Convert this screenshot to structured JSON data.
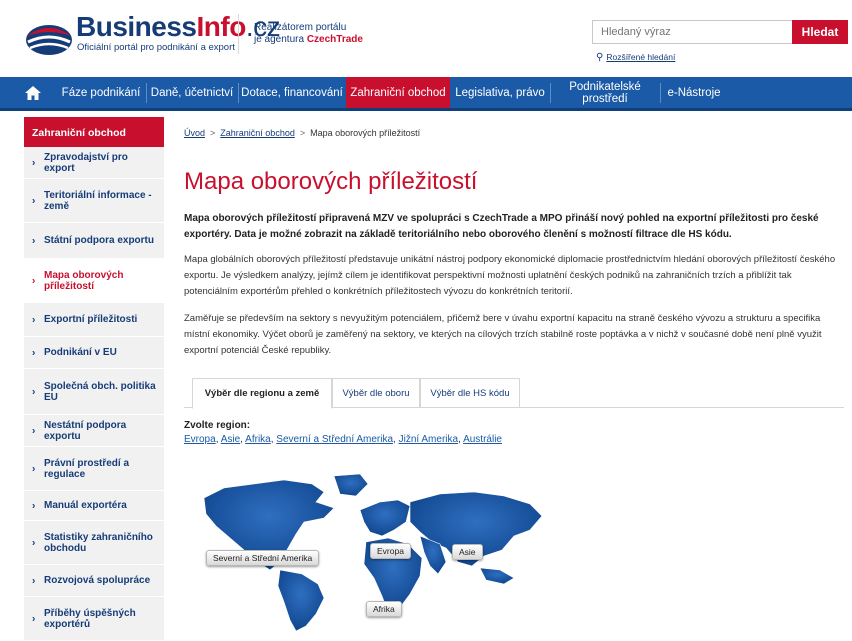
{
  "header": {
    "logo_main": "Business",
    "logo_info": "Info",
    "logo_cz": ".cz",
    "logo_sub": "Oficiální portál pro podnikání a export",
    "realizator_line1": "Realizátorem portálu",
    "realizator_line2": "je agentura",
    "realizator_brand": "CzechTrade",
    "search_placeholder": "Hledaný výraz",
    "search_button": "Hledat",
    "advanced_search": "Rozšířené hledání"
  },
  "nav": {
    "items": [
      {
        "label": "Fáze podnikání"
      },
      {
        "label": "Daně, účetnictví"
      },
      {
        "label": "Dotace, financování"
      },
      {
        "label": "Zahraniční obchod"
      },
      {
        "label": "Legislativa, právo"
      },
      {
        "label": "Podnikatelské prostředí"
      },
      {
        "label": "e-Nástroje"
      }
    ]
  },
  "sidebar": {
    "heading": "Zahraniční obchod",
    "items": [
      {
        "label": "Zpravodajství pro export"
      },
      {
        "label": "Teritoriální informace - země"
      },
      {
        "label": "Státní podpora exportu"
      },
      {
        "label": "Mapa oborových příležitostí"
      },
      {
        "label": "Exportní příležitosti"
      },
      {
        "label": "Podnikání v EU"
      },
      {
        "label": "Společná obch. politika EU"
      },
      {
        "label": "Nestátní podpora exportu"
      },
      {
        "label": "Právní prostředí a regulace"
      },
      {
        "label": "Manuál exportéra"
      },
      {
        "label": "Statistiky zahraničního obchodu"
      },
      {
        "label": "Rozvojová spolupráce"
      },
      {
        "label": "Příběhy úspěšných exportérů"
      }
    ]
  },
  "breadcrumb": {
    "home": "Úvod",
    "section": "Zahraniční obchod",
    "current": "Mapa oborových příležitostí"
  },
  "main": {
    "title": "Mapa oborových příležitostí",
    "lead": "Mapa oborových příležitostí připravená MZV ve spolupráci s CzechTrade a MPO přináší nový pohled na exportní příležitosti pro české exportéry. Data je možné zobrazit na základě teritoriálního nebo oborového členění s možností filtrace dle HS kódu.",
    "para1": "Mapa globálních oborových příležitostí představuje unikátní nástroj podpory ekonomické diplomacie prostřednictvím hledání oborových příležitostí českého exportu. Je výsledkem analýzy, jejímž cílem je identifikovat perspektivní možnosti uplatnění českých podniků na zahraničních trzích a přiblížit tak potenciálním exportérům přehled o konkrétních příležitostech vývozu do konkrétních teritorií.",
    "para2": "Zaměřuje se především na sektory s nevyužitým potenciálem, přičemž bere v úvahu exportní kapacitu na straně českého vývozu a strukturu a specifika místní ekonomiky. Výčet oborů je zaměřený na sektory, ve kterých na cílových trzích stabilně roste poptávka a v nichž v současné době není plně využit exportní potenciál České republiky.",
    "tabs": [
      {
        "label": "Výběr dle regionu a země"
      },
      {
        "label": "Výběr dle oboru"
      },
      {
        "label": "Výběr dle HS kódu"
      }
    ],
    "region_label": "Zvolte region:",
    "regions": [
      "Evropa",
      "Asie",
      "Afrika",
      "Severní a Střední Amerika",
      "Jižní Amerika",
      "Austrálie"
    ],
    "map_labels": {
      "north_america": "Severní a Střední Amerika",
      "europe": "Evropa",
      "asia": "Asie",
      "africa": "Afrika"
    }
  },
  "colors": {
    "brand_red": "#c8102e",
    "brand_blue": "#1b5aa6",
    "navy": "#163c78"
  }
}
